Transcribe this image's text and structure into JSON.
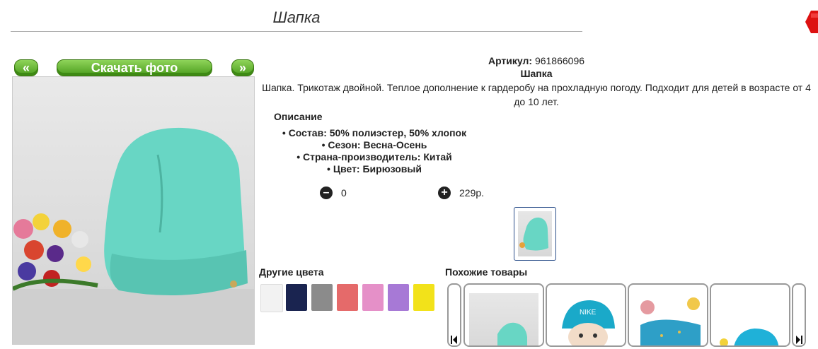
{
  "product": {
    "title": "Шапка",
    "article_label": "Артикул:",
    "article_value": "961866096",
    "name": "Шапка",
    "description": "Шапка. Трикотаж двойной. Теплое дополнение к гардеробу на прохладную погоду. Подходит для детей в возрасте от 4 до 10 лет.",
    "description_heading": "Описание",
    "properties": [
      "Состав: 50% полиэстер, 50% хлопок",
      "Сезон: Весна-Осень",
      "Страна-производитель: Китай",
      "Цвет: Бирюзовый"
    ],
    "quantity": "0",
    "price": "229р."
  },
  "nav": {
    "prev": "«",
    "download": "Скачать фото",
    "next": "»"
  },
  "other_colors": {
    "heading": "Другие цвета",
    "swatches": [
      "#f2f2f2",
      "#1a2450",
      "#8b8b8b",
      "#e56a6a",
      "#e590c8",
      "#a779d6",
      "#f2e21a"
    ]
  },
  "similar": {
    "heading": "Похожие товары"
  },
  "colors": {
    "button_green": "#5cae2a",
    "accent_red": "#d11",
    "hat": "#68d6c4"
  },
  "icons": [
    "close-icon",
    "minus-circle-icon",
    "plus-circle-icon",
    "chevron-left-icon",
    "chevron-right-icon"
  ]
}
